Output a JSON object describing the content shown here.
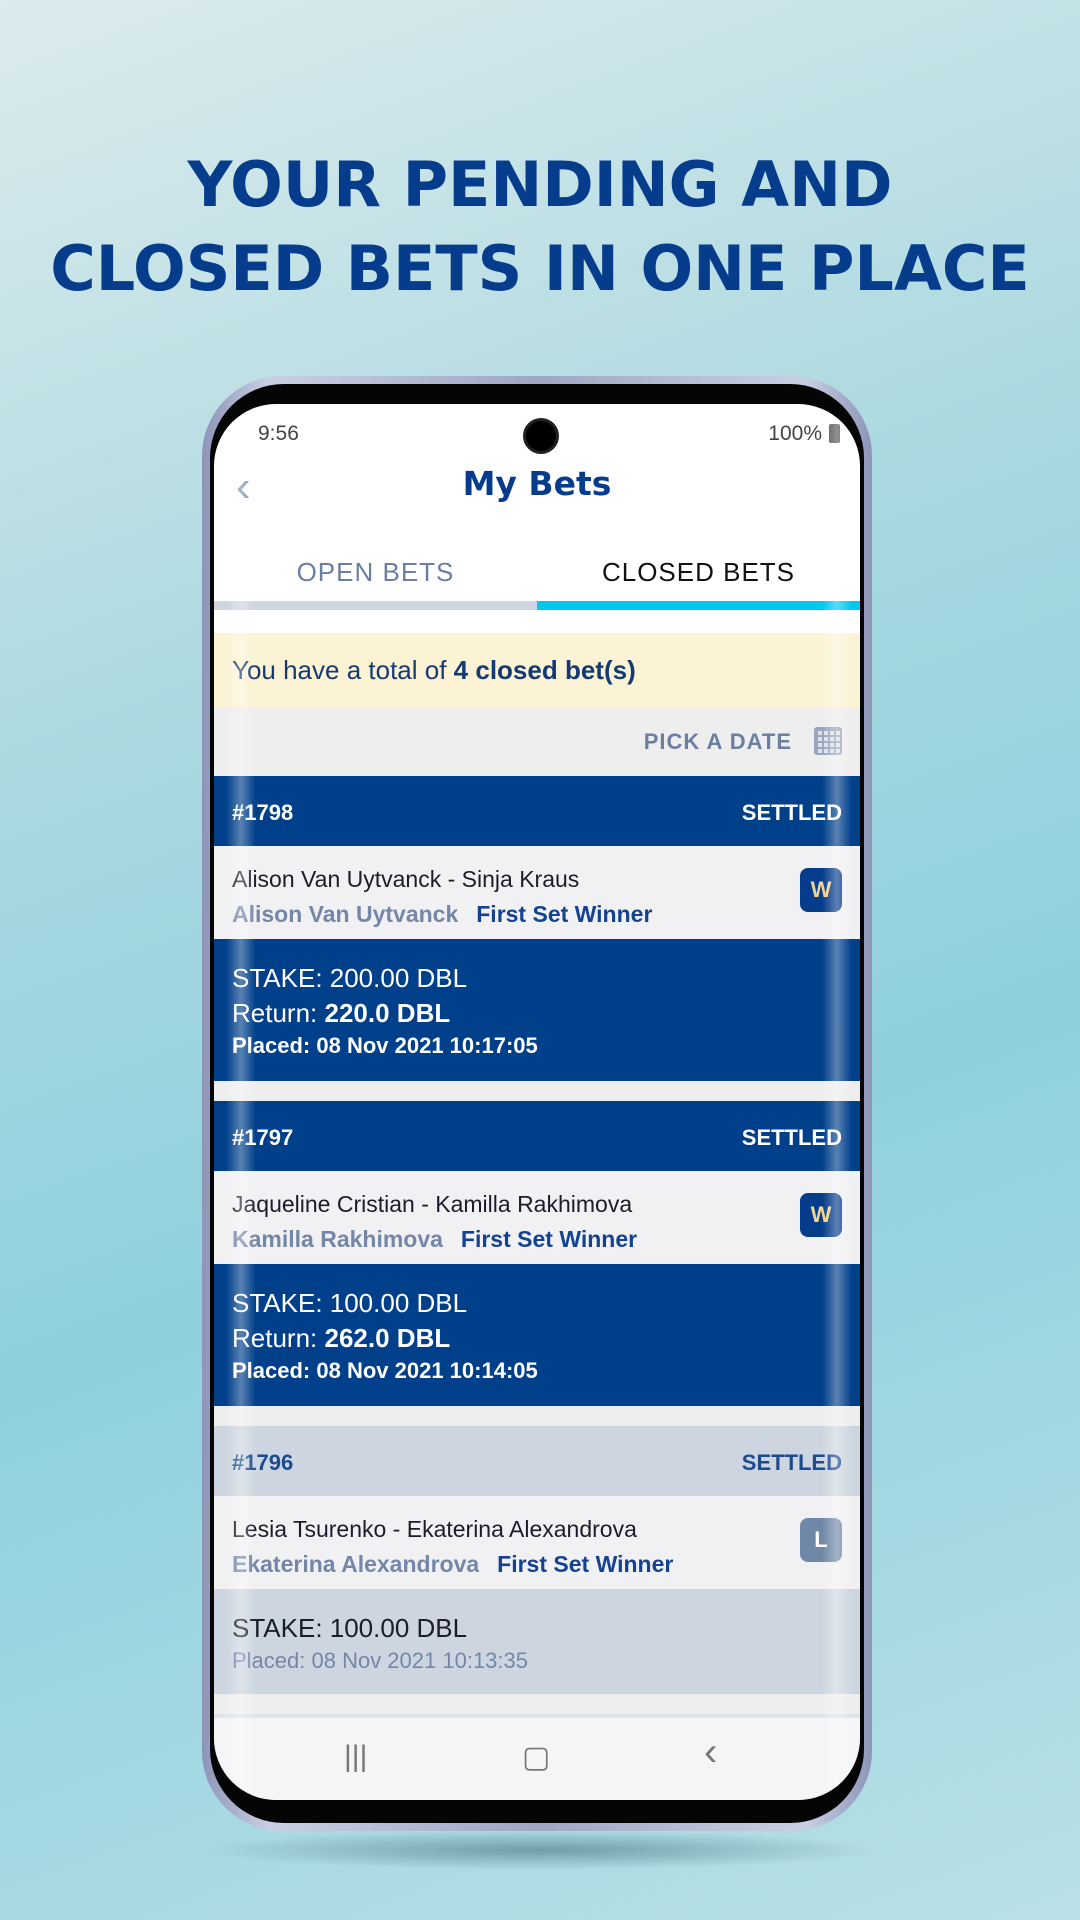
{
  "headline": {
    "line1": "YOUR PENDING AND",
    "line2": "CLOSED BETS IN ONE PLACE"
  },
  "status_bar": {
    "time": "9:56",
    "battery": "100%"
  },
  "header": {
    "title": "My Bets",
    "back_icon": "chevron-left-icon"
  },
  "tabs": [
    {
      "label": "OPEN BETS",
      "active": false
    },
    {
      "label": "CLOSED BETS",
      "active": true
    }
  ],
  "colors": {
    "brand": "#003f8a",
    "tab_indicator": "#00c8ee",
    "banner": "#fcf3d5"
  },
  "banner": {
    "prefix": "You have a total of",
    "highlight": "4 closed bet(s)"
  },
  "date_filter": {
    "label": "PICK A DATE",
    "icon": "calendar-icon"
  },
  "bets": [
    {
      "id": "#1798",
      "status": "SETTLED",
      "match": "Alison Van Uytvanck - Sinja Kraus",
      "selection": "Alison Van Uytvanck",
      "market": "First Set Winner",
      "result": "W",
      "stake": "STAKE: 200.00 DBL",
      "return_label": "Return:",
      "return_value": "220.0 DBL",
      "placed": "Placed: 08 Nov 2021 10:17:05"
    },
    {
      "id": "#1797",
      "status": "SETTLED",
      "match": "Jaqueline Cristian - Kamilla Rakhimova",
      "selection": "Kamilla Rakhimova",
      "market": "First Set Winner",
      "result": "W",
      "stake": "STAKE: 100.00 DBL",
      "return_label": "Return:",
      "return_value": "262.0 DBL",
      "placed": "Placed: 08 Nov 2021 10:14:05"
    },
    {
      "id": "#1796",
      "status": "SETTLED",
      "match": "Lesia Tsurenko - Ekaterina Alexandrova",
      "selection": "Ekaterina Alexandrova",
      "market": "First Set Winner",
      "result": "L",
      "stake": "STAKE: 100.00 DBL",
      "placed": "Placed: 08 Nov 2021 10:13:35"
    }
  ],
  "nav_bar": {
    "recents": "|||",
    "home": "▢",
    "back": "‹"
  }
}
